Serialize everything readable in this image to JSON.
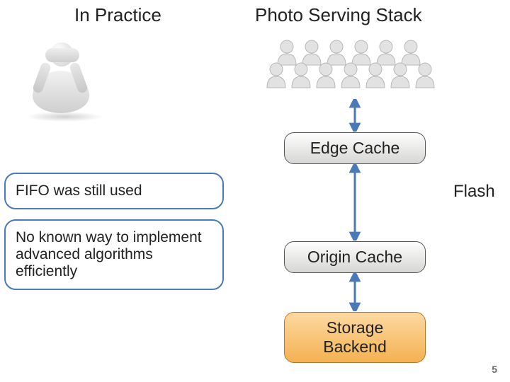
{
  "title_left": "In Practice",
  "title_right": "Photo Serving Stack",
  "callout_fifo": "FIFO was still used",
  "callout_noknown": "No known way to implement advanced algorithms efficiently",
  "node_edge": "Edge Cache",
  "node_origin": "Origin Cache",
  "node_storage": "Storage\nBackend",
  "label_flash": "Flash",
  "page_number": "5"
}
